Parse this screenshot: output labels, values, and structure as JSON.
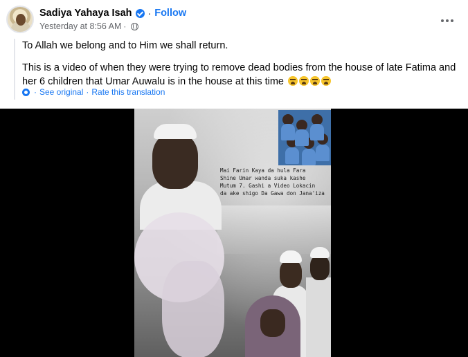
{
  "post": {
    "author": "Sadiya Yahaya Isah",
    "separator": "·",
    "follow_label": "Follow",
    "timestamp": "Yesterday at 8:56 AM",
    "meta_separator": "·",
    "paragraphs": [
      "To Allah we belong and to Him we shall return.",
      "This is a video of when they were trying to remove dead bodies from the house of late Fatima and her 6 children that Umar Auwalu is in the house at this time"
    ],
    "emoji_count": 4,
    "translation": {
      "see_original": "See original",
      "separator": "·",
      "rate_label": "Rate this translation"
    }
  },
  "video": {
    "caption": "Mai Farin Kaya da hula Fara\nShine Umar wanda suka kashe\nMutum 7. Gashi a Video Lokacin\nda ake shigo Da Gawa don Jana'iza"
  },
  "icons": {
    "verified": "verified-badge-icon",
    "globe": "globe-icon",
    "more": "more-options-icon",
    "gear": "gear-icon"
  },
  "colors": {
    "link": "#1877f2",
    "secondary_text": "#65676b",
    "video_bg": "#000000"
  }
}
